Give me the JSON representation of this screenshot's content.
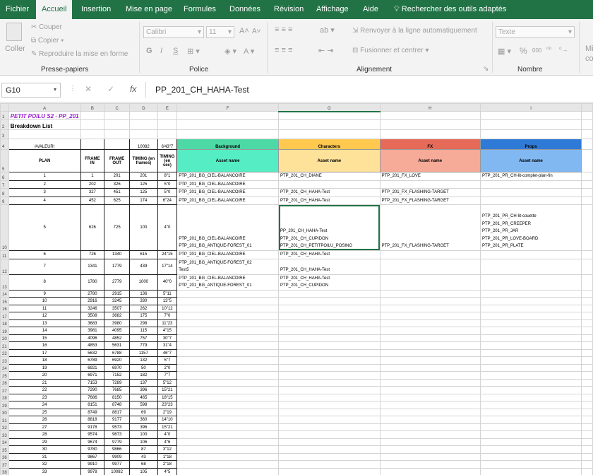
{
  "menu": {
    "items": [
      "Fichier",
      "Accueil",
      "Insertion",
      "Mise en page",
      "Formules",
      "Données",
      "Révision",
      "Affichage",
      "Aide"
    ],
    "search": "Rechercher des outils adaptés"
  },
  "ribbon": {
    "paste": "Coller",
    "cut": "Couper",
    "copy": "Copier",
    "painter": "Reproduire la mise en forme",
    "font_name": "Calibri",
    "font_size": "11",
    "wrap": "Renvoyer à la ligne automatiquement",
    "merge": "Fusionner et centrer",
    "number_format": "Texte",
    "bold": "G",
    "italic": "I",
    "underline": "S",
    "percent": "%",
    "thousands": "000",
    "partial": "Mi",
    "partial2": "co",
    "groups": [
      "Presse-papiers",
      "Police",
      "Alignement",
      "Nombre"
    ]
  },
  "formula_bar": {
    "name_box": "G10",
    "value": "PP_201_CH_HAHA-Test",
    "fx": "fx"
  },
  "columns": [
    "A",
    "B",
    "C",
    "D",
    "E",
    "F",
    "G",
    "H",
    "I"
  ],
  "sheet": {
    "title": "PETIT POILU S2 - PP_201",
    "subtitle": "Breakdown List",
    "row4": {
      "a": "#VALEUR!",
      "d": "10082",
      "e": "6'43\"7",
      "f": "Background",
      "g": "Characters",
      "h": "FX",
      "i": "Props"
    },
    "row5": {
      "a": "PLAN",
      "b": "FRAME IN",
      "c": "FRAME OUT",
      "d": "TIMING (en frames)",
      "e": "TIMING (en sec)",
      "f": "Asset name",
      "g": "Asset name",
      "h": "Asset name",
      "i": "Asset name"
    },
    "rows": [
      {
        "r": "6",
        "a": "1",
        "b": "1",
        "c": "201",
        "d": "201",
        "e": "8\"1",
        "f": [
          "PTP_201_BG_CIEL-BALANCOIRE"
        ],
        "g": [
          "PTP_201_CH_DIANE"
        ],
        "h": [
          "PTP_201_FX_LOVE"
        ],
        "i": [
          "PTP_201_PR_CH-lit-complet-plan-fin"
        ]
      },
      {
        "r": "7",
        "a": "2",
        "b": "202",
        "c": "326",
        "d": "125",
        "e": "5\"0",
        "f": [
          "PTP_201_BG_CIEL-BALANCOIRE"
        ],
        "g": [],
        "h": [],
        "i": []
      },
      {
        "r": "8",
        "a": "3",
        "b": "327",
        "c": "451",
        "d": "125",
        "e": "5\"0",
        "f": [
          "PTP_201_BG_CIEL-BALANCOIRE"
        ],
        "g": [
          "PTP_201_CH_HAHA-Test"
        ],
        "h": [
          "PTP_201_FX_FLASHING-TARGET"
        ],
        "i": []
      },
      {
        "r": "9",
        "a": "4",
        "b": "452",
        "c": "625",
        "d": "174",
        "e": "6\"24",
        "f": [
          "PTP_201_BG_CIEL-BALANCOIRE"
        ],
        "g": [
          "PTP_201_CH_HAHA-Test"
        ],
        "h": [
          "PTP_201_FX_FLASHING-TARGET"
        ],
        "i": []
      },
      {
        "r": "10",
        "a": "5",
        "b": "626",
        "c": "725",
        "d": "100",
        "e": "4\"0",
        "f": [
          "",
          "",
          "",
          "",
          "PTP_201_BG_CIEL-BALANCOIRE",
          "PTP_201_BG_ANTIQUE-FOREST_01"
        ],
        "g": [
          "",
          "",
          "PP_201_CH_HAHA-Test",
          "PTP_201_CH_CUPIDON",
          "PTP_201_CH_PETITPOILU_POSING"
        ],
        "h": [
          "",
          "",
          "",
          "",
          "PTP_201_FX_FLASHING-TARGET"
        ],
        "i": [
          "PTP_201_PR_CH-lit-couette",
          "PTP_201_PR_CREEPER",
          "PTP_201_PR_JAR",
          "PTP_201_PR_LOVE-BOARD",
          "PTP_201_PR_PLATE"
        ]
      },
      {
        "r": "11",
        "a": "6",
        "b": "726",
        "c": "1340",
        "d": "615",
        "e": "24\"15",
        "f": [
          "PTP_201_BG_CIEL-BALANCOIRE"
        ],
        "g": [
          "PTP_201_CH_HAHA-Test"
        ],
        "h": [],
        "i": []
      },
      {
        "r": "12",
        "a": "7",
        "b": "1341",
        "c": "1779",
        "d": "439",
        "e": "17\"14",
        "f": [
          "PTP_201_BG_ANTIQUE-FOREST_02",
          "Test5"
        ],
        "g": [
          "",
          "PTP_201_CH_HAHA-Test"
        ],
        "h": [],
        "i": []
      },
      {
        "r": "13",
        "a": "8",
        "b": "1780",
        "c": "2779",
        "d": "1000",
        "e": "40\"0",
        "f": [
          "PTP_201_BG_CIEL-BALANCOIRE",
          "PTP_201_BG_ANTIQUE-FOREST_01"
        ],
        "g": [
          "PTP_201_CH_HAHA-Test",
          "PTP_201_CH_CUPIDON"
        ],
        "h": [],
        "i": []
      },
      {
        "r": "14",
        "a": "9",
        "b": "2780",
        "c": "2915",
        "d": "136",
        "e": "5\"11"
      },
      {
        "r": "15",
        "a": "10",
        "b": "2916",
        "c": "3245",
        "d": "330",
        "e": "13\"5"
      },
      {
        "r": "16",
        "a": "11",
        "b": "3246",
        "c": "3507",
        "d": "262",
        "e": "10\"12"
      },
      {
        "r": "17",
        "a": "12",
        "b": "3508",
        "c": "3682",
        "d": "175",
        "e": "7\"0"
      },
      {
        "r": "18",
        "a": "13",
        "b": "3683",
        "c": "3980",
        "d": "298",
        "e": "11\"23"
      },
      {
        "r": "19",
        "a": "14",
        "b": "3981",
        "c": "4095",
        "d": "115",
        "e": "4\"15"
      },
      {
        "r": "20",
        "a": "15",
        "b": "4096",
        "c": "4852",
        "d": "757",
        "e": "30\"7"
      },
      {
        "r": "21",
        "a": "16",
        "b": "4853",
        "c": "5631",
        "d": "779",
        "e": "31\"4"
      },
      {
        "r": "22",
        "a": "17",
        "b": "5632",
        "c": "6788",
        "d": "1157",
        "e": "46\"7"
      },
      {
        "r": "23",
        "a": "18",
        "b": "6789",
        "c": "6920",
        "d": "132",
        "e": "5\"7"
      },
      {
        "r": "24",
        "a": "19",
        "b": "6921",
        "c": "6970",
        "d": "50",
        "e": "2\"0"
      },
      {
        "r": "25",
        "a": "20",
        "b": "6971",
        "c": "7152",
        "d": "182",
        "e": "7\"7"
      },
      {
        "r": "26",
        "a": "21",
        "b": "7153",
        "c": "7289",
        "d": "137",
        "e": "5\"12"
      },
      {
        "r": "27",
        "a": "22",
        "b": "7290",
        "c": "7685",
        "d": "396",
        "e": "15\"21"
      },
      {
        "r": "28",
        "a": "23",
        "b": "7686",
        "c": "8150",
        "d": "465",
        "e": "18\"15"
      },
      {
        "r": "29",
        "a": "24",
        "b": "8151",
        "c": "8748",
        "d": "598",
        "e": "23\"23"
      },
      {
        "r": "30",
        "a": "25",
        "b": "8749",
        "c": "8817",
        "d": "69",
        "e": "2\"19"
      },
      {
        "r": "31",
        "a": "26",
        "b": "8818",
        "c": "9177",
        "d": "360",
        "e": "14\"10"
      },
      {
        "r": "32",
        "a": "27",
        "b": "9178",
        "c": "9573",
        "d": "396",
        "e": "15\"21"
      },
      {
        "r": "33",
        "a": "28",
        "b": "9574",
        "c": "9673",
        "d": "100",
        "e": "4\"0"
      },
      {
        "r": "34",
        "a": "29",
        "b": "9674",
        "c": "9779",
        "d": "106",
        "e": "4\"6"
      },
      {
        "r": "35",
        "a": "30",
        "b": "9780",
        "c": "9866",
        "d": "87",
        "e": "3\"12"
      },
      {
        "r": "36",
        "a": "31",
        "b": "9867",
        "c": "9909",
        "d": "43",
        "e": "1\"18"
      },
      {
        "r": "37",
        "a": "32",
        "b": "9910",
        "c": "9977",
        "d": "68",
        "e": "2\"18"
      },
      {
        "r": "38",
        "a": "33",
        "b": "9978",
        "c": "10082",
        "d": "105",
        "e": "4\"5"
      }
    ]
  },
  "colors": {
    "excel_green": "#217346",
    "bg": "#4dd9a6",
    "bg_light": "#55edc4",
    "chars": "#ffc94f",
    "chars_light": "#ffe29a",
    "fx": "#e56b58",
    "fx_light": "#f6aa98",
    "props": "#2f7ad6",
    "props_light": "#82b8f2",
    "title": "#9b1fd2"
  }
}
